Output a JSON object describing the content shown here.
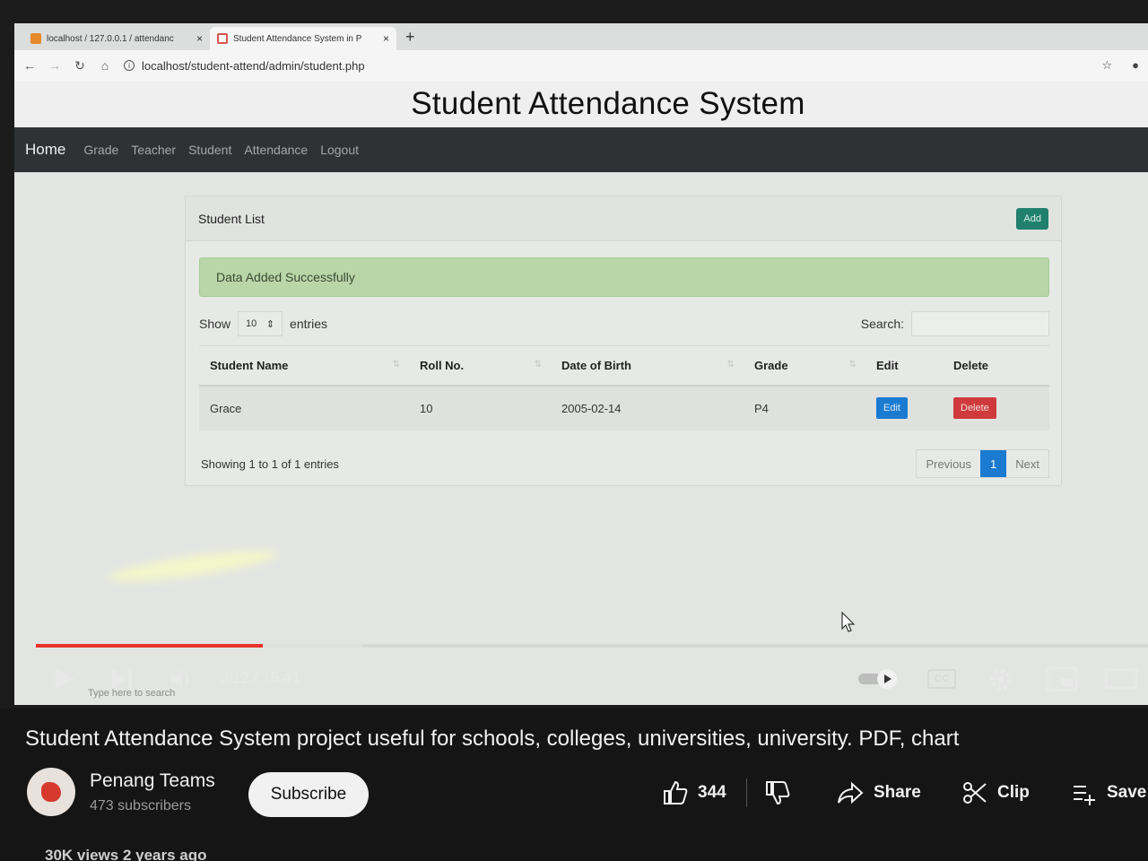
{
  "browser": {
    "tabs": [
      {
        "title": "localhost / 127.0.0.1 / attendanc",
        "close": "×"
      },
      {
        "title": "Student Attendance System in P",
        "close": "×"
      }
    ],
    "new_tab": "+",
    "url": "localhost/student-attend/admin/student.php"
  },
  "site": {
    "header_title": "Student Attendance System",
    "nav": {
      "brand": "Home",
      "links": [
        "Grade",
        "Teacher",
        "Student",
        "Attendance",
        "Logout"
      ]
    }
  },
  "student_list": {
    "card_title": "Student List",
    "add_label": "Add",
    "alert": "Data Added Successfully",
    "show_label": "Show",
    "entries_value": "10",
    "entries_label": "entries",
    "search_label": "Search:",
    "columns": [
      "Student Name",
      "Roll No.",
      "Date of Birth",
      "Grade",
      "Edit",
      "Delete"
    ],
    "rows": [
      {
        "name": "Grace",
        "roll": "10",
        "dob": "2005-02-14",
        "grade": "P4",
        "edit": "Edit",
        "delete": "Delete"
      }
    ],
    "info": "Showing 1 to 1 of 1 entries",
    "pager": {
      "previous": "Previous",
      "page": "1",
      "next": "Next"
    }
  },
  "os": {
    "taskbar_search": "Type here to search"
  },
  "player": {
    "time": "3:12 / 15:41",
    "progress_played": 0.204,
    "cc_label": "CC"
  },
  "youtube": {
    "title": "Student Attendance System project useful for schools, colleges, universities, university. PDF, chart",
    "channel": "Penang Teams",
    "subscribers": "473 subscribers",
    "subscribe": "Subscribe",
    "likes": "344",
    "share": "Share",
    "clip": "Clip",
    "save": "Save",
    "views": "30K views  2 years ago"
  },
  "colors": {
    "nav_bg": "#2f3234",
    "add_button": "#20806e",
    "alert_bg": "#b9d6a8",
    "edit_button": "#1a7bd0",
    "delete_button": "#d03a3c",
    "progress": "#e8322c"
  }
}
